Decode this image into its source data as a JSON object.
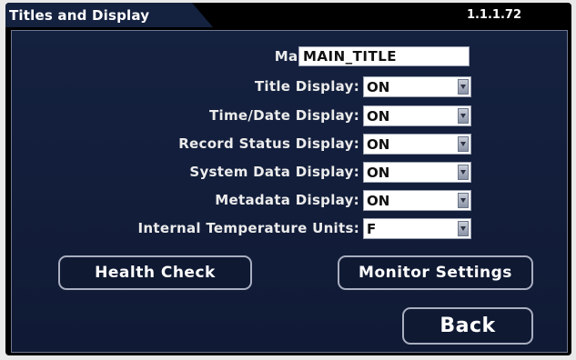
{
  "header": {
    "tab_title": "Titles and Display",
    "version": "1.1.1.72"
  },
  "form": {
    "main_title": {
      "label": "Main Title:",
      "value": "MAIN_TITLE"
    },
    "title_display": {
      "label": "Title Display:",
      "value": "ON"
    },
    "time_date_display": {
      "label": "Time/Date Display:",
      "value": "ON"
    },
    "record_status_display": {
      "label": "Record Status Display:",
      "value": "ON"
    },
    "system_data_display": {
      "label": "System Data Display:",
      "value": "ON"
    },
    "metadata_display": {
      "label": "Metadata Display:",
      "value": "ON"
    },
    "internal_temperature_units": {
      "label": "Internal Temperature Units:",
      "value": "F"
    }
  },
  "buttons": {
    "health_check": "Health Check",
    "monitor_settings": "Monitor Settings",
    "back": "Back"
  }
}
